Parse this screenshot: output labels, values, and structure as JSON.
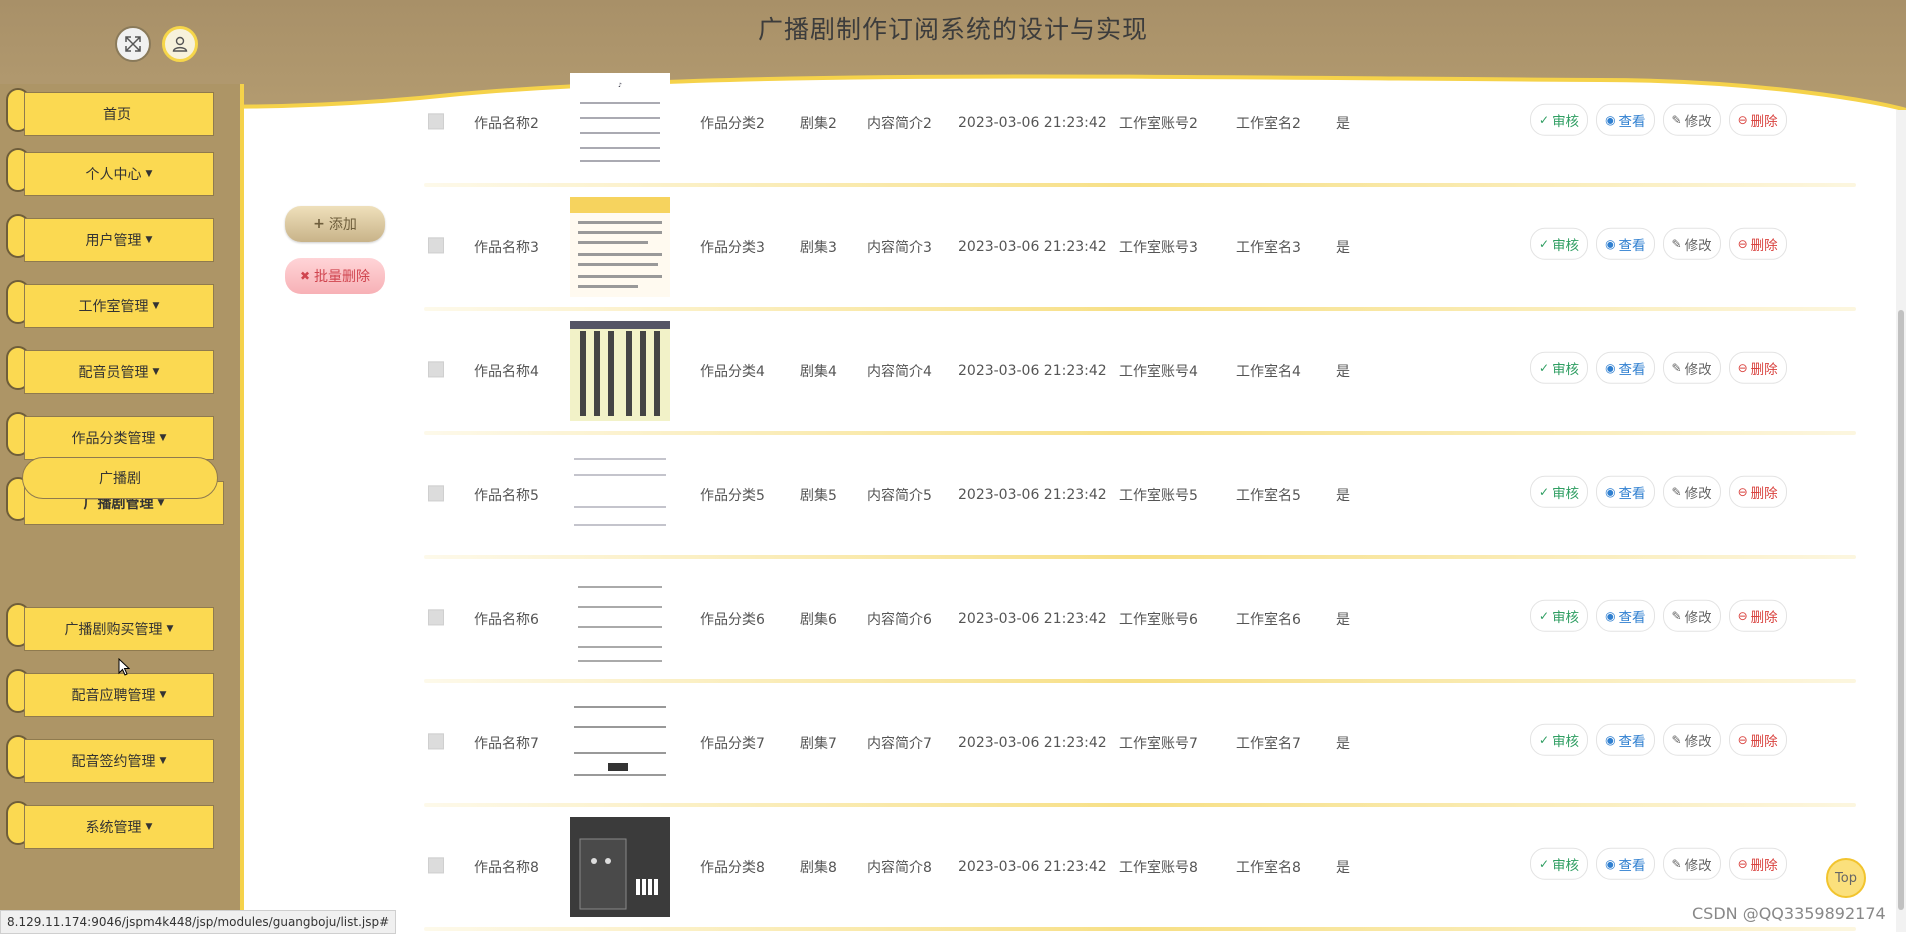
{
  "header": {
    "title": "广播剧制作订阅系统的设计与实现"
  },
  "sidebar": {
    "items": [
      {
        "label": "首页",
        "caret": ""
      },
      {
        "label": "个人中心",
        "caret": "▼"
      },
      {
        "label": "用户管理",
        "caret": "▼"
      },
      {
        "label": "工作室管理",
        "caret": "▼"
      },
      {
        "label": "配音员管理",
        "caret": "▼"
      },
      {
        "label": "作品分类管理",
        "caret": "▼"
      },
      {
        "label": "广播剧管理",
        "caret": "▼"
      },
      {
        "label": "广播剧购买管理",
        "caret": "▼"
      },
      {
        "label": "配音应聘管理",
        "caret": "▼"
      },
      {
        "label": "配音签约管理",
        "caret": "▼"
      },
      {
        "label": "系统管理",
        "caret": "▼"
      }
    ],
    "submenu": {
      "label": "广播剧"
    }
  },
  "toolbar": {
    "add_label": "添加",
    "add_icon": "+",
    "batch_delete_label": "批量删除",
    "batch_delete_icon": "✖"
  },
  "table": {
    "rows": [
      {
        "name": "作品名称2",
        "category": "作品分类2",
        "episode": "剧集2",
        "intro": "内容简介2",
        "time": "2023-03-06 21:23:42",
        "account": "工作室账号2",
        "studio": "工作室名2",
        "flag": "是"
      },
      {
        "name": "作品名称3",
        "category": "作品分类3",
        "episode": "剧集3",
        "intro": "内容简介3",
        "time": "2023-03-06 21:23:42",
        "account": "工作室账号3",
        "studio": "工作室名3",
        "flag": "是"
      },
      {
        "name": "作品名称4",
        "category": "作品分类4",
        "episode": "剧集4",
        "intro": "内容简介4",
        "time": "2023-03-06 21:23:42",
        "account": "工作室账号4",
        "studio": "工作室名4",
        "flag": "是"
      },
      {
        "name": "作品名称5",
        "category": "作品分类5",
        "episode": "剧集5",
        "intro": "内容简介5",
        "time": "2023-03-06 21:23:42",
        "account": "工作室账号5",
        "studio": "工作室名5",
        "flag": "是"
      },
      {
        "name": "作品名称6",
        "category": "作品分类6",
        "episode": "剧集6",
        "intro": "内容简介6",
        "time": "2023-03-06 21:23:42",
        "account": "工作室账号6",
        "studio": "工作室名6",
        "flag": "是"
      },
      {
        "name": "作品名称7",
        "category": "作品分类7",
        "episode": "剧集7",
        "intro": "内容简介7",
        "time": "2023-03-06 21:23:42",
        "account": "工作室账号7",
        "studio": "工作室名7",
        "flag": "是"
      },
      {
        "name": "作品名称8",
        "category": "作品分类8",
        "episode": "剧集8",
        "intro": "内容简介8",
        "time": "2023-03-06 21:23:42",
        "account": "工作室账号8",
        "studio": "工作室名8",
        "flag": "是"
      }
    ],
    "actions": {
      "approve": "审核",
      "approve_icon": "✓",
      "view": "查看",
      "view_icon": "◉",
      "edit": "修改",
      "edit_icon": "✎",
      "delete": "删除",
      "delete_icon": "⊖"
    }
  },
  "top_button": "Top",
  "status_url": "8.129.11.174:9046/jspm4k448/jsp/modules/guangboju/list.jsp#",
  "watermark": "CSDN @QQ3359892174",
  "colors": {
    "menu_yellow": "#fbd951",
    "header_tan": "#ad9566",
    "accent_border": "#f5d24a"
  }
}
